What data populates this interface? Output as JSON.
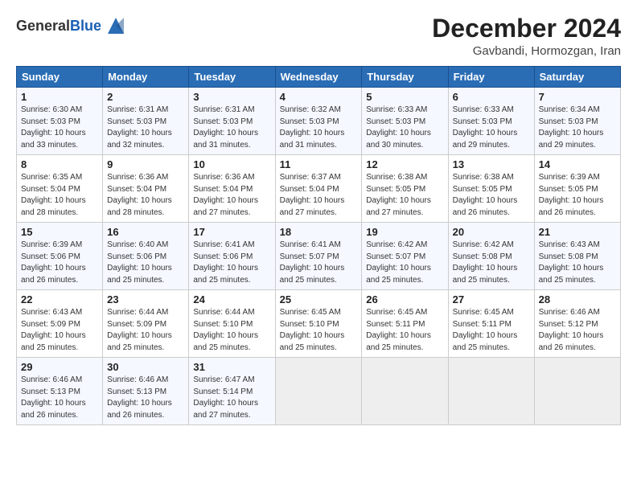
{
  "header": {
    "logo_general": "General",
    "logo_blue": "Blue",
    "title": "December 2024",
    "subtitle": "Gavbandi, Hormozgan, Iran"
  },
  "calendar": {
    "columns": [
      "Sunday",
      "Monday",
      "Tuesday",
      "Wednesday",
      "Thursday",
      "Friday",
      "Saturday"
    ],
    "rows": [
      [
        {
          "day": "1",
          "text": "Sunrise: 6:30 AM\nSunset: 5:03 PM\nDaylight: 10 hours\nand 33 minutes."
        },
        {
          "day": "2",
          "text": "Sunrise: 6:31 AM\nSunset: 5:03 PM\nDaylight: 10 hours\nand 32 minutes."
        },
        {
          "day": "3",
          "text": "Sunrise: 6:31 AM\nSunset: 5:03 PM\nDaylight: 10 hours\nand 31 minutes."
        },
        {
          "day": "4",
          "text": "Sunrise: 6:32 AM\nSunset: 5:03 PM\nDaylight: 10 hours\nand 31 minutes."
        },
        {
          "day": "5",
          "text": "Sunrise: 6:33 AM\nSunset: 5:03 PM\nDaylight: 10 hours\nand 30 minutes."
        },
        {
          "day": "6",
          "text": "Sunrise: 6:33 AM\nSunset: 5:03 PM\nDaylight: 10 hours\nand 29 minutes."
        },
        {
          "day": "7",
          "text": "Sunrise: 6:34 AM\nSunset: 5:03 PM\nDaylight: 10 hours\nand 29 minutes."
        }
      ],
      [
        {
          "day": "8",
          "text": "Sunrise: 6:35 AM\nSunset: 5:04 PM\nDaylight: 10 hours\nand 28 minutes."
        },
        {
          "day": "9",
          "text": "Sunrise: 6:36 AM\nSunset: 5:04 PM\nDaylight: 10 hours\nand 28 minutes."
        },
        {
          "day": "10",
          "text": "Sunrise: 6:36 AM\nSunset: 5:04 PM\nDaylight: 10 hours\nand 27 minutes."
        },
        {
          "day": "11",
          "text": "Sunrise: 6:37 AM\nSunset: 5:04 PM\nDaylight: 10 hours\nand 27 minutes."
        },
        {
          "day": "12",
          "text": "Sunrise: 6:38 AM\nSunset: 5:05 PM\nDaylight: 10 hours\nand 27 minutes."
        },
        {
          "day": "13",
          "text": "Sunrise: 6:38 AM\nSunset: 5:05 PM\nDaylight: 10 hours\nand 26 minutes."
        },
        {
          "day": "14",
          "text": "Sunrise: 6:39 AM\nSunset: 5:05 PM\nDaylight: 10 hours\nand 26 minutes."
        }
      ],
      [
        {
          "day": "15",
          "text": "Sunrise: 6:39 AM\nSunset: 5:06 PM\nDaylight: 10 hours\nand 26 minutes."
        },
        {
          "day": "16",
          "text": "Sunrise: 6:40 AM\nSunset: 5:06 PM\nDaylight: 10 hours\nand 25 minutes."
        },
        {
          "day": "17",
          "text": "Sunrise: 6:41 AM\nSunset: 5:06 PM\nDaylight: 10 hours\nand 25 minutes."
        },
        {
          "day": "18",
          "text": "Sunrise: 6:41 AM\nSunset: 5:07 PM\nDaylight: 10 hours\nand 25 minutes."
        },
        {
          "day": "19",
          "text": "Sunrise: 6:42 AM\nSunset: 5:07 PM\nDaylight: 10 hours\nand 25 minutes."
        },
        {
          "day": "20",
          "text": "Sunrise: 6:42 AM\nSunset: 5:08 PM\nDaylight: 10 hours\nand 25 minutes."
        },
        {
          "day": "21",
          "text": "Sunrise: 6:43 AM\nSunset: 5:08 PM\nDaylight: 10 hours\nand 25 minutes."
        }
      ],
      [
        {
          "day": "22",
          "text": "Sunrise: 6:43 AM\nSunset: 5:09 PM\nDaylight: 10 hours\nand 25 minutes."
        },
        {
          "day": "23",
          "text": "Sunrise: 6:44 AM\nSunset: 5:09 PM\nDaylight: 10 hours\nand 25 minutes."
        },
        {
          "day": "24",
          "text": "Sunrise: 6:44 AM\nSunset: 5:10 PM\nDaylight: 10 hours\nand 25 minutes."
        },
        {
          "day": "25",
          "text": "Sunrise: 6:45 AM\nSunset: 5:10 PM\nDaylight: 10 hours\nand 25 minutes."
        },
        {
          "day": "26",
          "text": "Sunrise: 6:45 AM\nSunset: 5:11 PM\nDaylight: 10 hours\nand 25 minutes."
        },
        {
          "day": "27",
          "text": "Sunrise: 6:45 AM\nSunset: 5:11 PM\nDaylight: 10 hours\nand 25 minutes."
        },
        {
          "day": "28",
          "text": "Sunrise: 6:46 AM\nSunset: 5:12 PM\nDaylight: 10 hours\nand 26 minutes."
        }
      ],
      [
        {
          "day": "29",
          "text": "Sunrise: 6:46 AM\nSunset: 5:13 PM\nDaylight: 10 hours\nand 26 minutes."
        },
        {
          "day": "30",
          "text": "Sunrise: 6:46 AM\nSunset: 5:13 PM\nDaylight: 10 hours\nand 26 minutes."
        },
        {
          "day": "31",
          "text": "Sunrise: 6:47 AM\nSunset: 5:14 PM\nDaylight: 10 hours\nand 27 minutes."
        },
        {
          "day": "",
          "text": ""
        },
        {
          "day": "",
          "text": ""
        },
        {
          "day": "",
          "text": ""
        },
        {
          "day": "",
          "text": ""
        }
      ]
    ]
  }
}
